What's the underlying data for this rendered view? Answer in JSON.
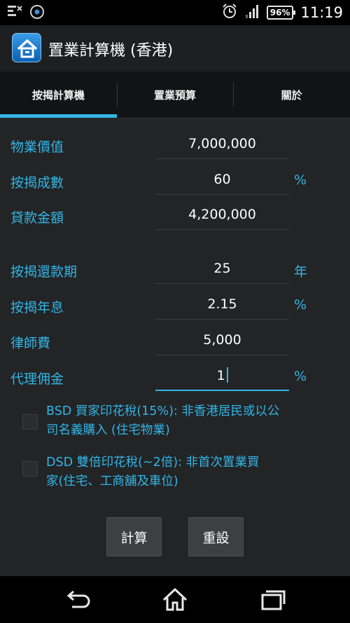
{
  "status_bar": {
    "battery_percent": "96%",
    "time": "11:19",
    "icons": [
      "notification-icon",
      "sync-icon",
      "alarm-clock-icon",
      "signal-icon",
      "battery-icon"
    ]
  },
  "app_bar": {
    "title": "置業計算機 (香港)",
    "icon": "house-icon"
  },
  "tabs": [
    {
      "label": "按揭計算機",
      "active": true
    },
    {
      "label": "置業預算",
      "active": false
    },
    {
      "label": "關於",
      "active": false
    }
  ],
  "form": {
    "property_value": {
      "label": "物業價值",
      "value": "7,000,000",
      "unit": ""
    },
    "mortgage_ratio": {
      "label": "按揭成數",
      "value": "60",
      "unit": "%"
    },
    "loan_amount": {
      "label": "貸款金額",
      "value": "4,200,000",
      "unit": ""
    },
    "repayment_period": {
      "label": "按揭還款期",
      "value": "25",
      "unit": "年"
    },
    "interest_rate": {
      "label": "按揭年息",
      "value": "2.15",
      "unit": "%"
    },
    "legal_fee": {
      "label": "律師費",
      "value": "5,000",
      "unit": ""
    },
    "agent_commission": {
      "label": "代理佣金",
      "value": "1",
      "unit": "%"
    }
  },
  "checkboxes": {
    "bsd": {
      "label_line1": "BSD 買家印花稅(15%): 非香港居民或以公",
      "label_line2": "司名義購入 (住宅物業)",
      "checked": false
    },
    "dsd": {
      "label_line1": "DSD 雙倍印花稅(~2倍): 非首次置業買",
      "label_line2": "家(住宅、工商舖及車位)",
      "checked": false
    }
  },
  "buttons": {
    "calculate": "計算",
    "reset": "重設"
  },
  "nav": [
    "back-icon",
    "home-icon",
    "recent-apps-icon"
  ],
  "colors": {
    "accent": "#33b5e5",
    "background": "#222426",
    "action_bar": "#1d1f21",
    "button": "#3d3f42"
  }
}
